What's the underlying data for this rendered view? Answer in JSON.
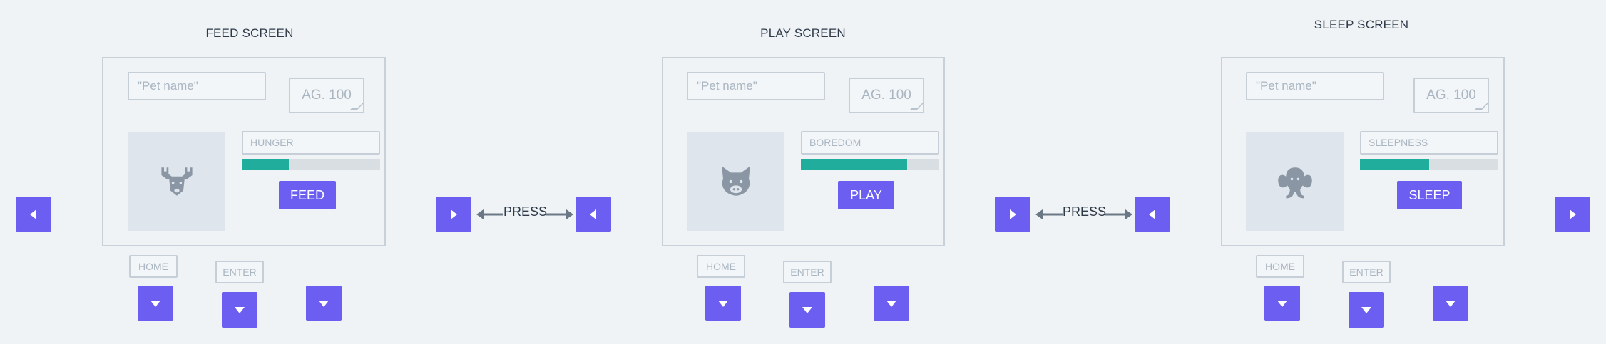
{
  "colors": {
    "accent": "#6b5ef0",
    "progress": "#21ad9b",
    "frame": "#c8d1da",
    "background": "#eff3f6"
  },
  "screens": [
    {
      "title": "FEED SCREEN",
      "name_placeholder": "\"Pet name\"",
      "age": "AG. 100",
      "pet_icon": "deer-icon",
      "stat_label": "HUNGER",
      "stat_fraction": 0.34,
      "action_label": "FEED",
      "home_label": "HOME",
      "enter_label": "ENTER"
    },
    {
      "title": "PLAY SCREEN",
      "name_placeholder": "\"Pet name\"",
      "age": "AG. 100",
      "pet_icon": "pig-icon",
      "stat_label": "BOREDOM",
      "stat_fraction": 0.77,
      "action_label": "PLAY",
      "home_label": "HOME",
      "enter_label": "ENTER"
    },
    {
      "title": "SLEEP SCREEN",
      "name_placeholder": "\"Pet name\"",
      "age": "AG. 100",
      "pet_icon": "elephant-icon",
      "stat_label": "SLEEPNESS",
      "stat_fraction": 0.5,
      "action_label": "SLEEP",
      "home_label": "HOME",
      "enter_label": "ENTER"
    }
  ],
  "connectors": [
    {
      "label": "PRESS"
    },
    {
      "label": "PRESS"
    }
  ]
}
